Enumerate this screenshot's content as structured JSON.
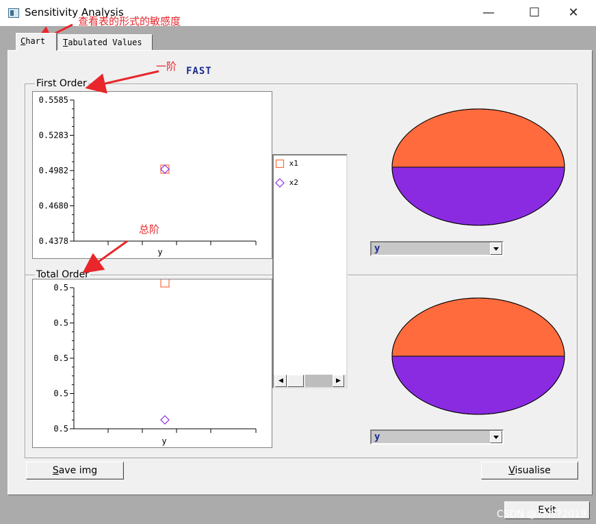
{
  "window": {
    "title": "Sensitivity Analysis",
    "minimize_icon": "minimize-icon",
    "maximize_icon": "maximize-icon",
    "close_icon": "close-icon",
    "minimize_glyph": "—",
    "maximize_glyph": "☐",
    "close_glyph": "✕"
  },
  "tabs": [
    {
      "mnemonic": "C",
      "rest": "hart"
    },
    {
      "mnemonic": "T",
      "rest": "abulated Values"
    }
  ],
  "chart_title": "FAST",
  "groups": {
    "first_order": "First Order",
    "total_order": "Total Order"
  },
  "chart_data": [
    {
      "type": "scatter",
      "title": "FAST",
      "group": "First Order",
      "categories": [
        "y"
      ],
      "yticks": [
        "0.5585",
        "0.5283",
        "0.4982",
        "0.4680",
        "0.4378"
      ],
      "ylim": [
        0.4378,
        0.5585
      ],
      "series": [
        {
          "name": "x1",
          "marker": "square",
          "color": "#ff6b3d",
          "values": [
            0.4982
          ]
        },
        {
          "name": "x2",
          "marker": "diamond",
          "color": "#8a2be2",
          "values": [
            0.4982
          ]
        }
      ]
    },
    {
      "type": "scatter",
      "group": "Total Order",
      "categories": [
        "y"
      ],
      "yticks": [
        "0.5",
        "0.5",
        "0.5",
        "0.5",
        "0.5"
      ],
      "series": [
        {
          "name": "x1",
          "marker": "square",
          "color": "#ff6b3d",
          "values": [
            0.5
          ]
        },
        {
          "name": "x2",
          "marker": "diamond",
          "color": "#8a2be2",
          "values": [
            0.5
          ]
        }
      ]
    },
    {
      "type": "pie",
      "group": "First Order",
      "labels": [
        "x1",
        "x2"
      ],
      "values": [
        0.4982,
        0.4982
      ],
      "colors": [
        "#ff6b3d",
        "#8a2be2"
      ]
    },
    {
      "type": "pie",
      "group": "Total Order",
      "labels": [
        "x1",
        "x2"
      ],
      "values": [
        0.5,
        0.5
      ],
      "colors": [
        "#ff6b3d",
        "#8a2be2"
      ]
    }
  ],
  "legend": [
    {
      "name": "x1",
      "icon": "square-marker-icon"
    },
    {
      "name": "x2",
      "icon": "diamond-marker-icon"
    }
  ],
  "combos": {
    "first": "y",
    "second": "y"
  },
  "buttons": {
    "save": {
      "mnemonic": "S",
      "rest": "ave img"
    },
    "visualise": {
      "mnemonic": "V",
      "rest": "isualise"
    },
    "exit": "Exit"
  },
  "annotations": {
    "tab_note": "查看表的形式的敏感度",
    "first_note": "一阶",
    "total_note": "总阶"
  },
  "watermark": "CSDN @?????2019",
  "colors": {
    "accent": "#e8262b",
    "x1": "#ff6b3d",
    "x2": "#8a2be2",
    "title_blue": "#1a2a8c"
  }
}
